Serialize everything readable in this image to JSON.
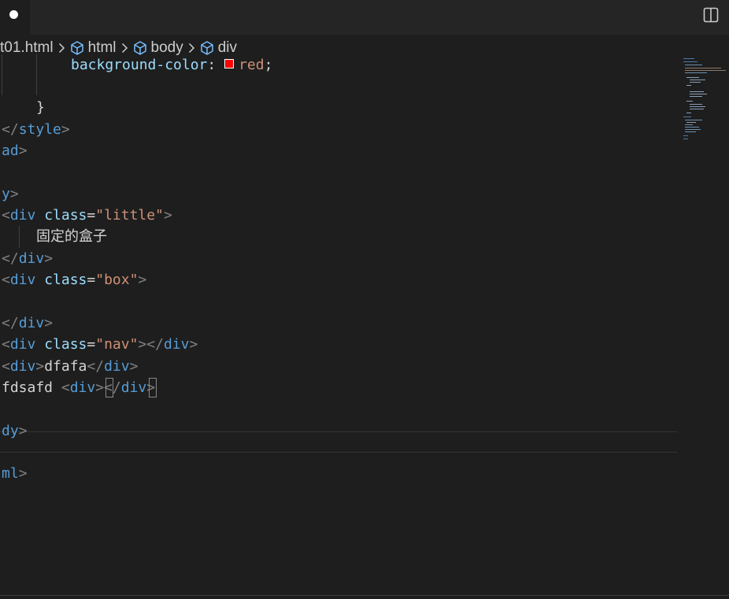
{
  "breadcrumb": {
    "file": "t01.html",
    "items": [
      "html",
      "body",
      "div"
    ]
  },
  "colors": {
    "editor_bg": "#1e1e1e",
    "tag": "#569cd6",
    "attr": "#9cdcfe",
    "string": "#ce9178",
    "text": "#d4d4d4",
    "swatch": "#ff0000"
  },
  "code": {
    "css_prop": "background-color",
    "css_colon": ": ",
    "css_value": "red",
    "css_semi": ";",
    "close_brace": "}",
    "style_close": "</style>",
    "head_close_frag": "ad>",
    "body_open_frag": "y>",
    "div_little_open": "<div",
    "class_attr": "class",
    "eq": "=",
    "little_value": "\"little\"",
    "gt": ">",
    "little_text": "固定的盒子",
    "div_close": "</div>",
    "box_value": "\"box\"",
    "nav_value": "\"nav\"",
    "div_open_short": "<div>",
    "dfafa_text": "dfafa",
    "fdsafd_text": "fdsafd ",
    "body_close_frag": "dy>",
    "html_close_frag": "ml>"
  },
  "icons": {
    "dirty": "dot-icon",
    "split": "split-editor-icon",
    "element": "cube-icon",
    "chevron": "chevron-right-icon"
  }
}
